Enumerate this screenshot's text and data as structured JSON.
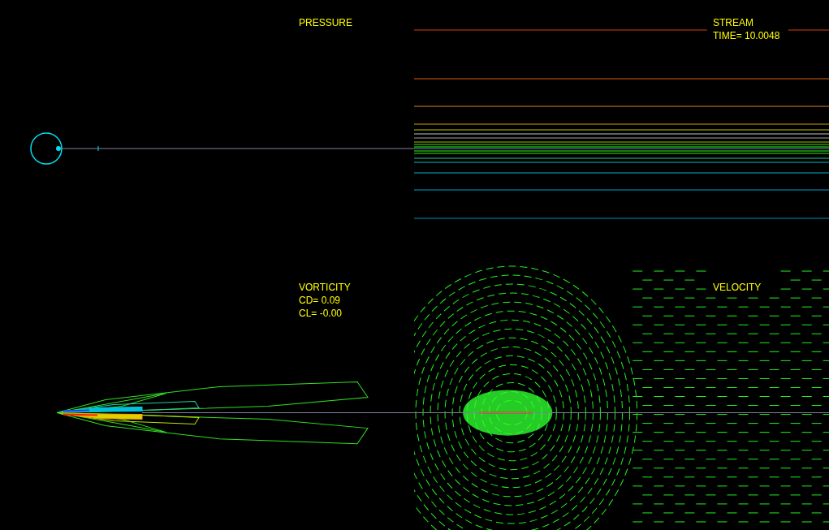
{
  "panels": [
    {
      "kind": "pressure",
      "lines": [
        "PRESSURE"
      ]
    },
    {
      "kind": "stream",
      "lines": [
        "STREAM",
        "TIME= 10.0048"
      ]
    },
    {
      "kind": "vorticity",
      "lines": [
        "VORTICITY",
        "CD= 0.09",
        "CL= -0.00"
      ]
    },
    {
      "kind": "velocity",
      "lines": [
        "VELOCITY"
      ]
    }
  ]
}
